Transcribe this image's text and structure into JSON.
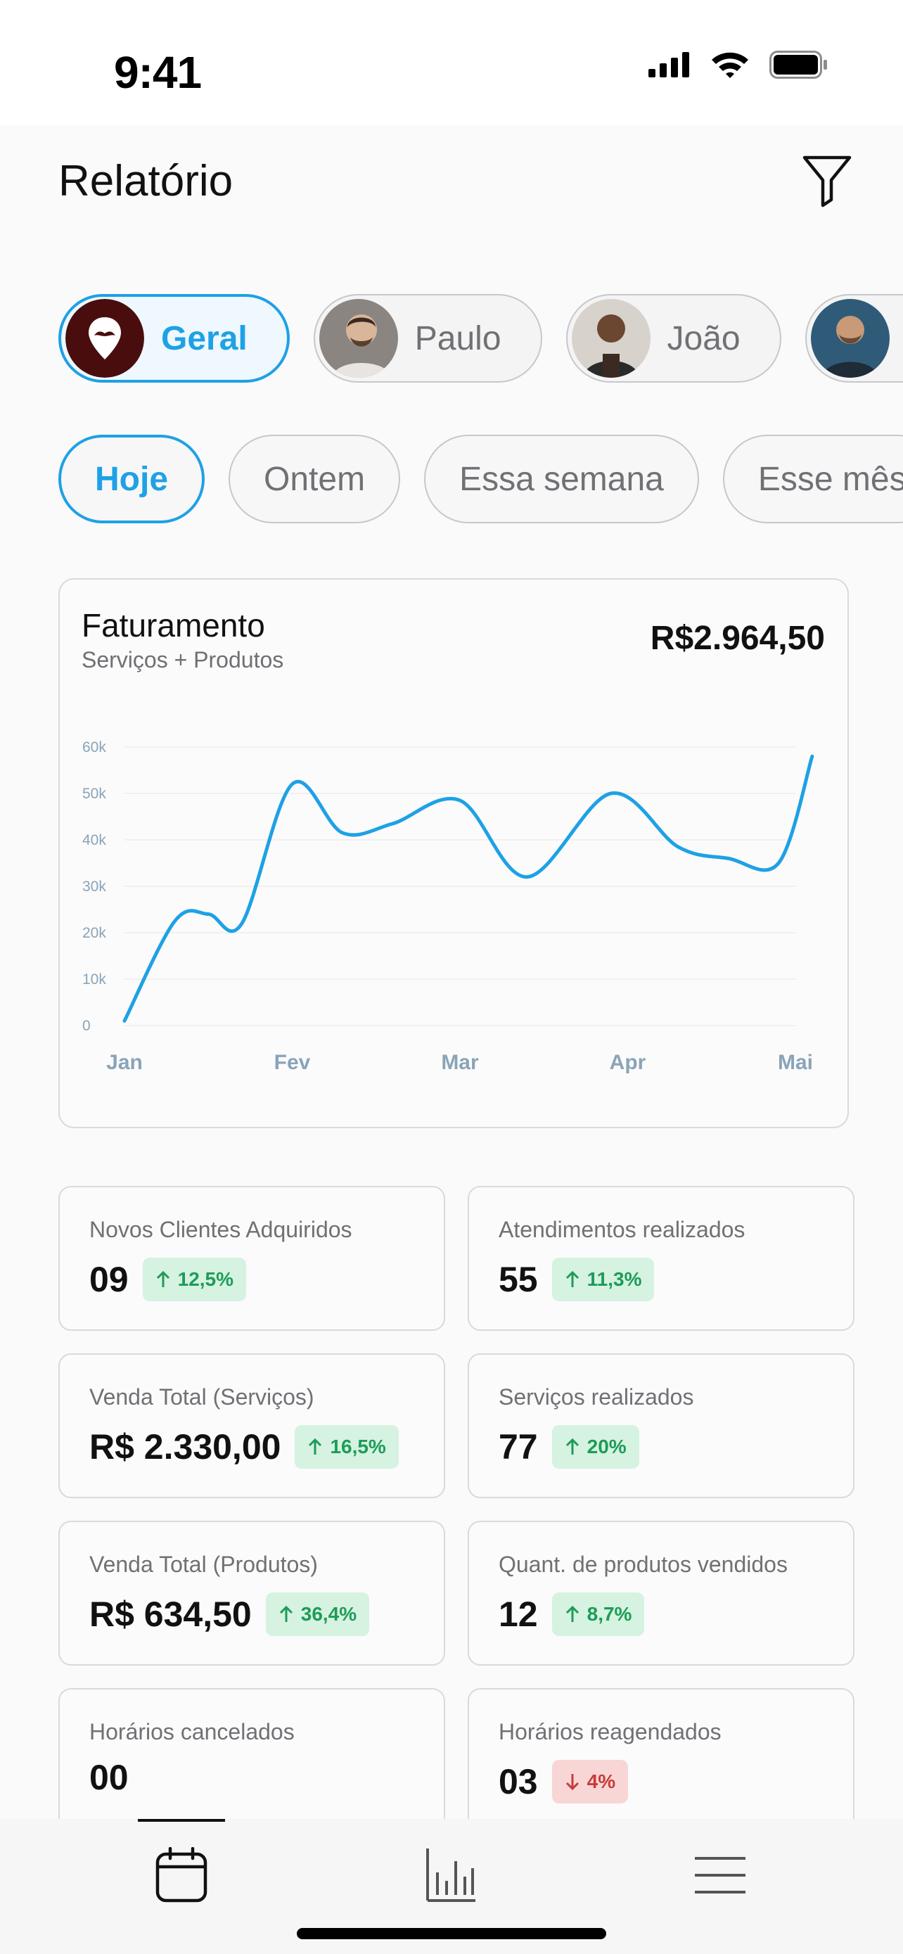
{
  "status_bar": {
    "time": "9:41"
  },
  "header": {
    "title": "Relatório"
  },
  "profiles": [
    {
      "label": "Geral",
      "active": true
    },
    {
      "label": "Paulo",
      "active": false
    },
    {
      "label": "João",
      "active": false
    },
    {
      "label": "",
      "active": false
    }
  ],
  "periods": [
    {
      "label": "Hoje",
      "active": true
    },
    {
      "label": "Ontem",
      "active": false
    },
    {
      "label": "Essa semana",
      "active": false
    },
    {
      "label": "Esse mês",
      "active": false
    }
  ],
  "revenue": {
    "title": "Faturamento",
    "subtitle": "Serviços + Produtos",
    "value": "R$2.964,50"
  },
  "chart_data": {
    "type": "line",
    "title": "Faturamento",
    "subtitle": "Serviços + Produtos",
    "x_labels": [
      "Jan",
      "Fev",
      "Mar",
      "Apr",
      "Mai"
    ],
    "y_ticks": [
      "0",
      "10k",
      "20k",
      "30k",
      "40k",
      "50k",
      "60k"
    ],
    "ylim": [
      0,
      60000
    ],
    "grid": true,
    "color": "#1ea1e5",
    "x": [
      0,
      0.3,
      0.5,
      0.7,
      1.0,
      1.3,
      1.6,
      2.0,
      2.4,
      2.9,
      3.3,
      3.6,
      3.9,
      4.1
    ],
    "values": [
      1000,
      22500,
      24000,
      22000,
      52000,
      41500,
      43500,
      48500,
      32000,
      50000,
      38500,
      36000,
      35000,
      58000
    ]
  },
  "metrics": [
    {
      "label": "Novos Clientes Adquiridos",
      "value": "09",
      "change": "12,5%",
      "trend": "up"
    },
    {
      "label": "Atendimentos realizados",
      "value": "55",
      "change": "11,3%",
      "trend": "up"
    },
    {
      "label": "Venda Total (Serviços)",
      "value": "R$ 2.330,00",
      "change": "16,5%",
      "trend": "up"
    },
    {
      "label": "Serviços realizados",
      "value": "77",
      "change": "20%",
      "trend": "up"
    },
    {
      "label": "Venda Total (Produtos)",
      "value": "R$ 634,50",
      "change": "36,4%",
      "trend": "up"
    },
    {
      "label": "Quant. de produtos vendidos",
      "value": "12",
      "change": "8,7%",
      "trend": "up"
    },
    {
      "label": "Horários cancelados",
      "value": "00",
      "change": "",
      "trend": "none"
    },
    {
      "label": "Horários reagendados",
      "value": "03",
      "change": "4%",
      "trend": "down"
    }
  ],
  "nav": {
    "items": [
      {
        "icon": "calendar-icon",
        "active": true
      },
      {
        "icon": "bar-chart-icon",
        "active": false
      },
      {
        "icon": "menu-icon",
        "active": false
      }
    ]
  },
  "colors": {
    "accent": "#1ea1e5",
    "up": "#1d9c58",
    "down": "#c73b3b"
  }
}
